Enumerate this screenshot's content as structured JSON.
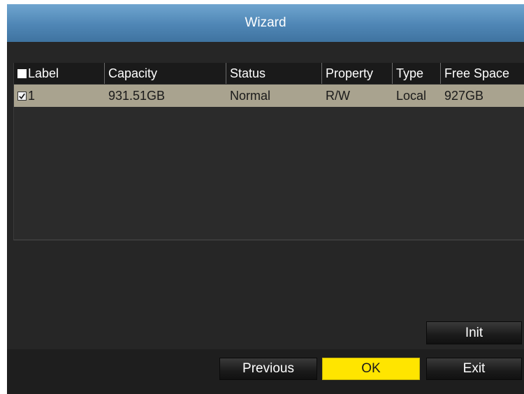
{
  "window": {
    "title": "Wizard"
  },
  "table": {
    "headers": {
      "label": "Label",
      "capacity": "Capacity",
      "status": "Status",
      "property": "Property",
      "type": "Type",
      "free_space": "Free Space"
    },
    "header_checkbox_checked": false,
    "rows": [
      {
        "checked": true,
        "label": "1",
        "capacity": "931.51GB",
        "status": "Normal",
        "property": "R/W",
        "type": "Local",
        "free_space": "927GB"
      }
    ]
  },
  "buttons": {
    "init": "Init",
    "previous": "Previous",
    "ok": "OK",
    "exit": "Exit"
  },
  "colors": {
    "title_bar": "#4f86b5",
    "selected_row": "#a9a38f",
    "ok_button": "#ffe500"
  },
  "icons": {
    "checkmark": "check-icon"
  }
}
